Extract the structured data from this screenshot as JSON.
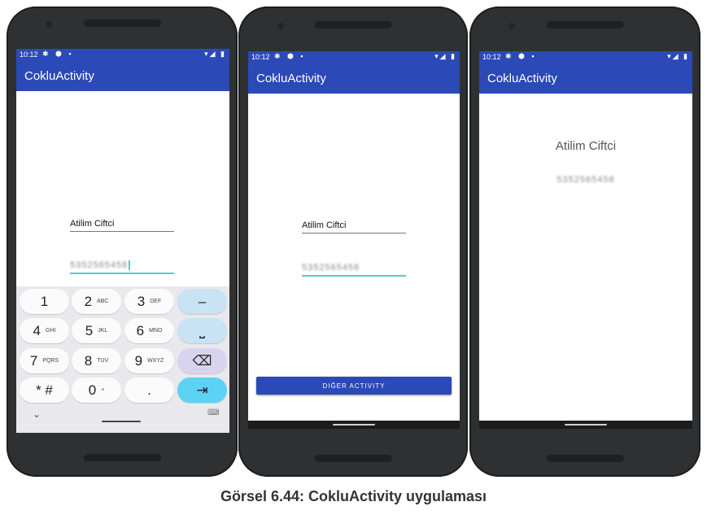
{
  "screens": [
    {
      "status_time": "10:12",
      "app_title": "CokluActivity",
      "name_value": "Atilim Ciftci",
      "phone_value": "5352565458",
      "keyboard": {
        "rows": [
          [
            {
              "main": "1",
              "sub": ""
            },
            {
              "main": "2",
              "sub": "ABC"
            },
            {
              "main": "3",
              "sub": "DEF"
            },
            {
              "main": "–",
              "sub": ""
            }
          ],
          [
            {
              "main": "4",
              "sub": "GHI"
            },
            {
              "main": "5",
              "sub": "JKL"
            },
            {
              "main": "6",
              "sub": "MNO"
            },
            {
              "main": "⎵",
              "sub": ""
            }
          ],
          [
            {
              "main": "7",
              "sub": "PQRS"
            },
            {
              "main": "8",
              "sub": "TUV"
            },
            {
              "main": "9",
              "sub": "WXYZ"
            },
            {
              "main": "⌫",
              "sub": ""
            }
          ],
          [
            {
              "main": "* #",
              "sub": ""
            },
            {
              "main": "0",
              "sub": "+"
            },
            {
              "main": ".",
              "sub": ""
            },
            {
              "main": "⇥",
              "sub": ""
            }
          ]
        ],
        "chevron": "⌄",
        "keyboard_switch": "⌨"
      }
    },
    {
      "status_time": "10:12",
      "app_title": "CokluActivity",
      "name_value": "Atilim Ciftci",
      "phone_value": "5352565458",
      "button_label": "DIĞER ACTIVITY"
    },
    {
      "status_time": "10:12",
      "app_title": "CokluActivity",
      "name_text": "Atilim Ciftci",
      "phone_text": "5352565458"
    }
  ],
  "status_icons_left": "✱ ⬢ ▪",
  "status_icons_right": "▾◢ ▮",
  "caption": "Görsel 6.44: CokluActivity uygulaması"
}
